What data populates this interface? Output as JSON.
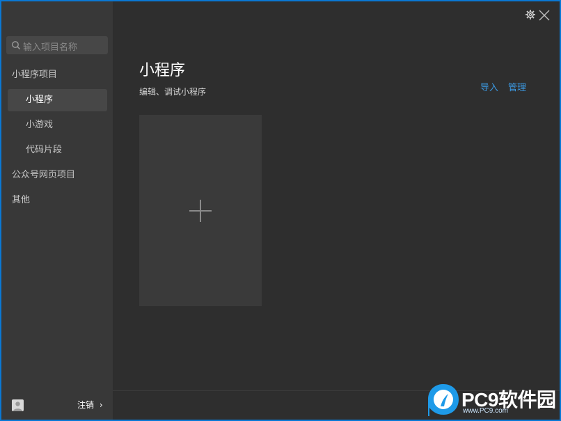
{
  "sidebar": {
    "search_placeholder": "输入项目名称",
    "sections": [
      {
        "label": "小程序项目"
      },
      {
        "label": "公众号网页项目"
      },
      {
        "label": "其他"
      }
    ],
    "sub_items": [
      {
        "label": "小程序",
        "active": true
      },
      {
        "label": "小游戏",
        "active": false
      },
      {
        "label": "代码片段",
        "active": false
      }
    ],
    "logout_label": "注销",
    "logout_chevron": "›"
  },
  "main": {
    "title": "小程序",
    "subtitle": "编辑、调试小程序",
    "import_label": "导入",
    "manage_label": "管理"
  },
  "icons": {
    "search": "search-icon",
    "settings": "gear-icon",
    "close": "close-icon",
    "add": "plus-icon",
    "avatar": "user-avatar-icon"
  },
  "watermark": {
    "brand": "PC9软件园",
    "url": "www.PC9.com"
  },
  "colors": {
    "accent_link": "#3b9ae4",
    "window_bg": "#2e2e2e",
    "sidebar_bg": "#383838"
  }
}
